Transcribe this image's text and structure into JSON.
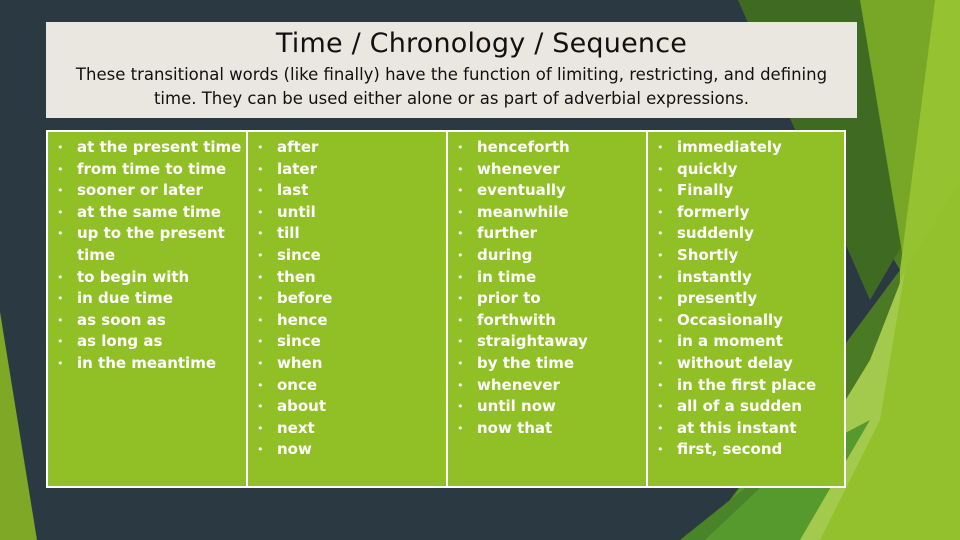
{
  "slide": {
    "title": "Time / Chronology / Sequence",
    "description": "These transitional words (like finally) have the function of limiting, restricting, and defining time. They can be used either alone or as part of adverbial expressions."
  },
  "colors": {
    "background": "#2b3a42",
    "header_box": "#e9e7df",
    "table_fill": "#91c026",
    "table_border": "#ffffff",
    "accent_dark_green": "#4a7a24",
    "accent_mid_green": "#7aa826",
    "accent_light_green": "#9cc73a"
  },
  "bullet_glyph": "•",
  "columns": [
    {
      "items": [
        "at the present time",
        "from time to time",
        "sooner or later",
        "at the same time",
        "up to the present time",
        "to begin with",
        "in due time",
        "as soon as",
        "as long as",
        "in the meantime"
      ]
    },
    {
      "items": [
        "after",
        "later",
        "last",
        "until",
        "till",
        "since",
        "then",
        "before",
        "hence",
        "since",
        "when",
        "once",
        "about",
        "next",
        "now"
      ]
    },
    {
      "items": [
        "henceforth",
        "whenever",
        "eventually",
        "meanwhile",
        "further",
        "during",
        "in time",
        "prior to",
        "forthwith",
        "straightaway",
        "by the time",
        "whenever",
        "until now",
        "now that"
      ]
    },
    {
      "items": [
        "immediately",
        "quickly",
        "Finally",
        "formerly",
        "suddenly",
        "Shortly",
        "instantly",
        "presently",
        "Occasionally",
        "in a moment",
        "without delay",
        "in the first place",
        "all of a sudden",
        "at this instant",
        "first, second"
      ]
    }
  ]
}
